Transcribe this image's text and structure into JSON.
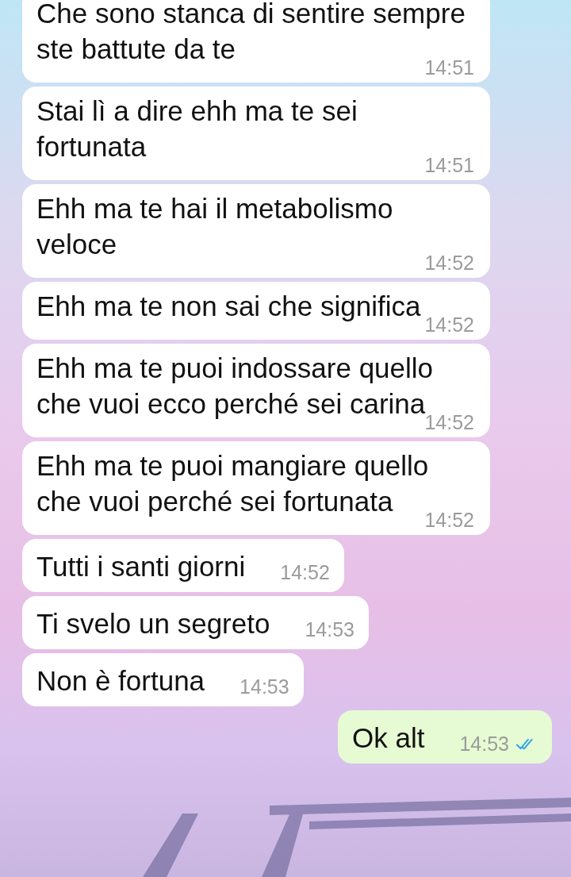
{
  "messages": [
    {
      "kind": "block",
      "sent": false,
      "text": "Che sono stanca di sentire sempre ste battute da te",
      "time": "14:51"
    },
    {
      "kind": "block",
      "sent": false,
      "text": "Stai lì a dire ehh ma te sei fortunata",
      "time": "14:51"
    },
    {
      "kind": "block",
      "sent": false,
      "text": "Ehh ma te hai il metabolismo veloce",
      "time": "14:52"
    },
    {
      "kind": "block",
      "sent": false,
      "text": "Ehh ma te non sai che significa",
      "time": "14:52"
    },
    {
      "kind": "block",
      "sent": false,
      "text": "Ehh ma te puoi indossare quello che vuoi ecco perché sei carina",
      "time": "14:52"
    },
    {
      "kind": "block",
      "sent": false,
      "text": "Ehh ma te puoi mangiare quello che vuoi perché sei fortunata",
      "time": "14:52"
    },
    {
      "kind": "inline",
      "sent": false,
      "text": "Tutti i santi giorni",
      "time": "14:52"
    },
    {
      "kind": "inline",
      "sent": false,
      "text": "Ti svelo un segreto",
      "time": "14:53"
    },
    {
      "kind": "inline",
      "sent": false,
      "text": "Non è fortuna",
      "time": "14:53"
    },
    {
      "kind": "inline",
      "sent": true,
      "text": "Ok alt",
      "time": "14:53",
      "read": true
    }
  ]
}
